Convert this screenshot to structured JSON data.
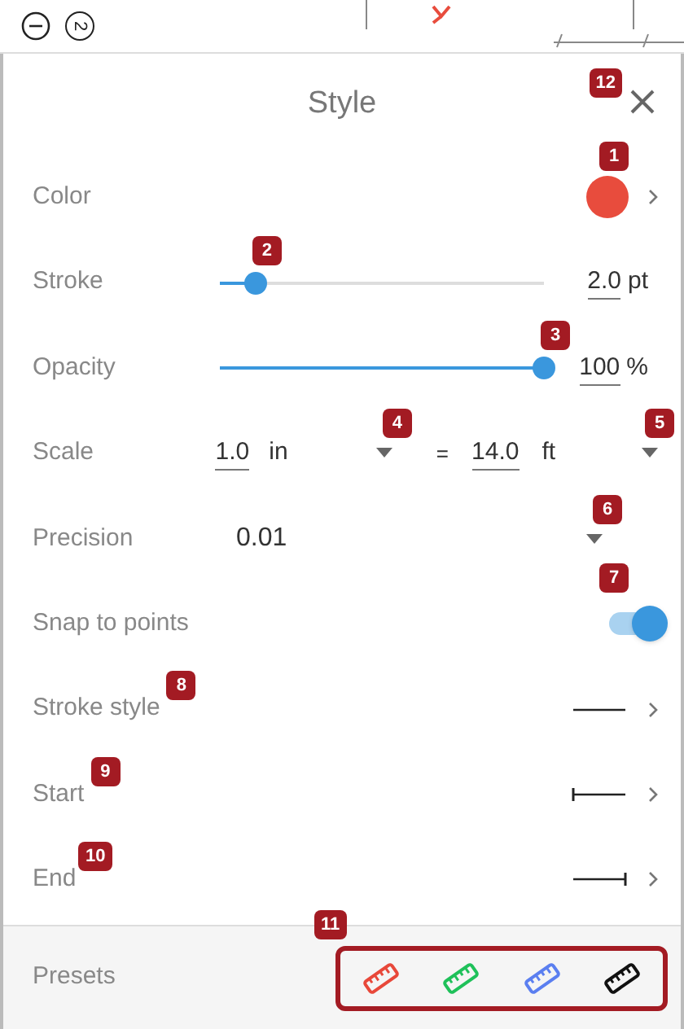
{
  "canvas": {
    "counter": "2"
  },
  "panel": {
    "title": "Style",
    "close_badge": "12"
  },
  "rows": [
    {
      "kind": "color",
      "label": "Color",
      "color": "#e84c3d",
      "badge": "1"
    },
    {
      "kind": "slider",
      "label": "Stroke",
      "level": 0.11,
      "value": "2.0",
      "unit": "pt",
      "badge": "2"
    },
    {
      "kind": "slider",
      "label": "Opacity",
      "level": 1,
      "value": "100",
      "unit": "%",
      "badge": "3"
    },
    {
      "kind": "scale",
      "label": "Scale",
      "value_a": "1.0",
      "unit_a": "in",
      "badge_a": "4",
      "sign": "=",
      "value_b": "14.0",
      "unit_b": "ft",
      "badge_b": "5"
    },
    {
      "kind": "dropdown",
      "label": "Precision",
      "value": "0.01",
      "badge": "6"
    },
    {
      "kind": "toggle",
      "label": "Snap to points",
      "on": true,
      "badge": "7"
    },
    {
      "kind": "line",
      "label": "Stroke style",
      "start_bar": false,
      "end_bar": false,
      "badge": "8"
    },
    {
      "kind": "line",
      "label": "Start",
      "start_bar": true,
      "end_bar": false,
      "badge": "9"
    },
    {
      "kind": "line",
      "label": "End",
      "start_bar": false,
      "end_bar": true,
      "badge": "10"
    }
  ],
  "presets": {
    "label": "Presets",
    "badge": "11",
    "items": [
      {
        "color": "#e8483a"
      },
      {
        "color": "#1fc15a"
      },
      {
        "color": "#5b7ff0"
      },
      {
        "color": "#111111"
      }
    ]
  }
}
